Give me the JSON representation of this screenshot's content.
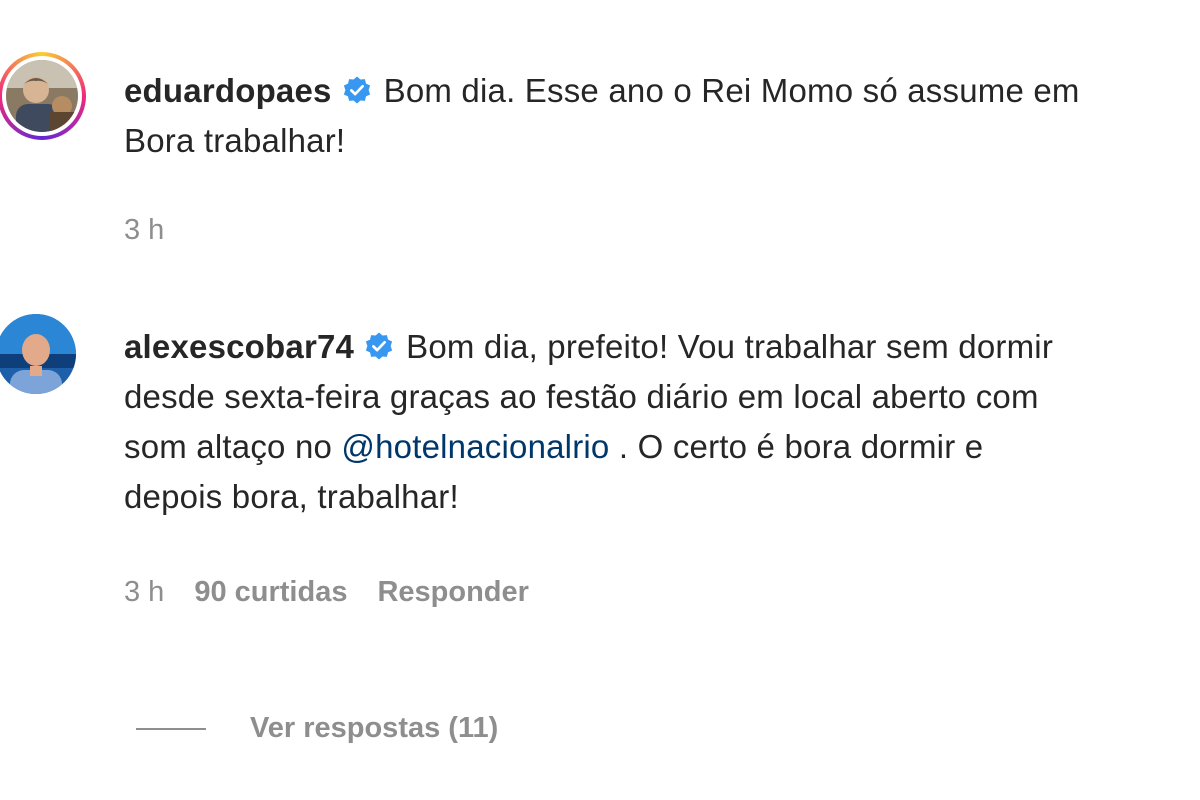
{
  "post": {
    "username": "eduardopaes",
    "line1": "Bom dia. Esse ano o Rei Momo só assume em",
    "line2": "Bora trabalhar!",
    "time": "3 h"
  },
  "comment": {
    "username": "alexescobar74",
    "line1": "Bom dia, prefeito! Vou trabalhar sem dormir",
    "line2": "desde sexta-feira graças ao festão diário em local aberto com",
    "line3_pre": "som altaço no ",
    "mention": "@hotelnacionalrio",
    "line3_post": " . O certo é bora dormir e",
    "line4": "depois bora, trabalhar!",
    "time": "3 h",
    "likes": "90 curtidas",
    "reply_label": "Responder"
  },
  "replies": {
    "label": "Ver respostas (11)"
  },
  "colors": {
    "text": "#262626",
    "muted": "#8e8e8e",
    "verified": "#3897f0",
    "mention": "#00376b"
  }
}
